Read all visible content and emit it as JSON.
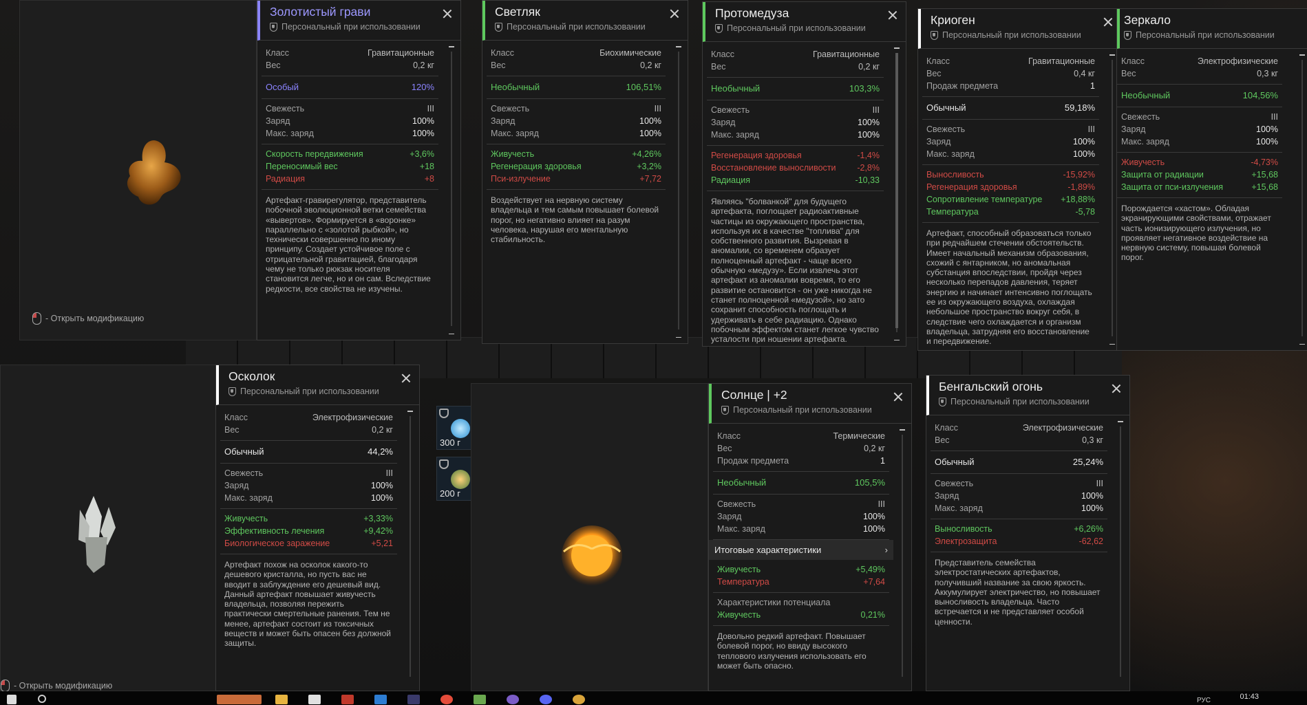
{
  "preview": {
    "open_mod_label": "- Открыть модификацию"
  },
  "slots": [
    {
      "weight": "300 г"
    },
    {
      "weight": "200 г"
    }
  ],
  "taskbar": {
    "time": "01:43",
    "lang": "РУС"
  },
  "cards": {
    "zolotisty": {
      "title": "Золотистый грави",
      "subtitle": "Персональный при использовании",
      "base": [
        {
          "k": "Класс",
          "v": "Гравитационные"
        },
        {
          "k": "Вес",
          "v": "0,2 кг"
        }
      ],
      "rarity": {
        "k": "Особый",
        "v": "120%",
        "color": "#8b84ff"
      },
      "charge": [
        {
          "k": "Свежесть",
          "v": "III"
        },
        {
          "k": "Заряд",
          "v": "100%"
        },
        {
          "k": "Макс. заряд",
          "v": "100%"
        }
      ],
      "effects": [
        {
          "k": "Скорость передвижения",
          "v": "+3,6%",
          "t": "pos"
        },
        {
          "k": "Переносимый вес",
          "v": "+18",
          "t": "pos"
        },
        {
          "k": "Радиация",
          "v": "+8",
          "t": "neg"
        }
      ],
      "desc": "Артефакт-гравирегулятор, представитель побочной эволюционной ветки семейства «вывертов». Формируется в «воронке» параллельно с «золотой рыбкой», но технически совершенно по иному принципу. Создает устойчивое поле с отрицательной гравитацией, благодаря чему не только рюкзак носителя становится легче, но и он сам. Вследствие редкости, все свойства не изучены."
    },
    "svetlyak": {
      "title": "Светляк",
      "subtitle": "Персональный при использовании",
      "base": [
        {
          "k": "Класс",
          "v": "Биохимические"
        },
        {
          "k": "Вес",
          "v": "0,2 кг"
        }
      ],
      "rarity": {
        "k": "Необычный",
        "v": "106,51%",
        "color": "#5fc85f"
      },
      "charge": [
        {
          "k": "Свежесть",
          "v": "III"
        },
        {
          "k": "Заряд",
          "v": "100%"
        },
        {
          "k": "Макс. заряд",
          "v": "100%"
        }
      ],
      "effects": [
        {
          "k": "Живучесть",
          "v": "+4,26%",
          "t": "pos"
        },
        {
          "k": "Регенерация здоровья",
          "v": "+3,2%",
          "t": "pos"
        },
        {
          "k": "Пси-излучение",
          "v": "+7,72",
          "t": "neg"
        }
      ],
      "desc": "Воздействует на нервную систему владельца и тем самым повышает болевой порог, но негативно влияет на разум человека, нарушая его ментальную стабильность."
    },
    "protomeduza": {
      "title": "Протомедуза",
      "subtitle": "Персональный при использовании",
      "base": [
        {
          "k": "Класс",
          "v": "Гравитационные"
        },
        {
          "k": "Вес",
          "v": "0,2 кг"
        }
      ],
      "rarity": {
        "k": "Необычный",
        "v": "103,3%",
        "color": "#5fc85f"
      },
      "charge": [
        {
          "k": "Свежесть",
          "v": "III"
        },
        {
          "k": "Заряд",
          "v": "100%"
        },
        {
          "k": "Макс. заряд",
          "v": "100%"
        }
      ],
      "effects": [
        {
          "k": "Регенерация здоровья",
          "v": "-1,4%",
          "t": "neg"
        },
        {
          "k": "Восстановление выносливости",
          "v": "-2,8%",
          "t": "neg"
        },
        {
          "k": "Радиация",
          "v": "-10,33",
          "t": "pos"
        }
      ],
      "desc": "Являясь \"болванкой\" для будущего артефакта, поглощает радиоактивные частицы из окружающего пространства, используя их в качестве \"топлива\" для собственного развития. Вызревая в аномалии, со временем образует полноценный артефакт - чаще всего обычную «медузу». Если извлечь этот артефакт из аномалии вовремя, то его развитие остановится - он уже никогда не станет полноценной «медузой», но зато сохранит способность поглощать и удерживать в себе радиацию. Однако побочным эффектом станет легкое чувство усталости при ношении артефакта."
    },
    "kriogen": {
      "title": "Криоген",
      "subtitle": "Персональный при использовании",
      "base": [
        {
          "k": "Класс",
          "v": "Гравитационные"
        },
        {
          "k": "Вес",
          "v": "0,4 кг"
        },
        {
          "k": "Продаж предмета",
          "v": "1"
        }
      ],
      "rarity": {
        "k": "Обычный",
        "v": "59,18%",
        "color": "#e8e8e8"
      },
      "charge": [
        {
          "k": "Свежесть",
          "v": "III"
        },
        {
          "k": "Заряд",
          "v": "100%"
        },
        {
          "k": "Макс. заряд",
          "v": "100%"
        }
      ],
      "effects": [
        {
          "k": "Выносливость",
          "v": "-15,92%",
          "t": "neg"
        },
        {
          "k": "Регенерация здоровья",
          "v": "-1,89%",
          "t": "neg"
        },
        {
          "k": "Сопротивление температуре",
          "v": "+18,88%",
          "t": "pos"
        },
        {
          "k": "Температура",
          "v": "-5,78",
          "t": "pos"
        }
      ],
      "desc": "Артефакт, способный образоваться только при редчайшем стечении обстоятельств. Имеет начальный механизм образования, схожий с янтарником, но аномальная субстанция впоследствии, пройдя через несколько перепадов давления, теряет энергию и начинает интенсивно поглощать ее из окружающего воздуха, охлаждая небольшое пространство вокруг себя, в следствие чего охлаждается и организм владельца, затрудняя его восстановление и передвижение."
    },
    "zerkalo": {
      "title": "Зеркало",
      "subtitle": "Персональный при использовании",
      "base": [
        {
          "k": "Класс",
          "v": "Электрофизические"
        },
        {
          "k": "Вес",
          "v": "0,3 кг"
        }
      ],
      "rarity": {
        "k": "Необычный",
        "v": "104,56%",
        "color": "#5fc85f"
      },
      "charge": [
        {
          "k": "Свежесть",
          "v": "III"
        },
        {
          "k": "Заряд",
          "v": "100%"
        },
        {
          "k": "Макс. заряд",
          "v": "100%"
        }
      ],
      "effects": [
        {
          "k": "Живучесть",
          "v": "-4,73%",
          "t": "neg"
        },
        {
          "k": "Защита от радиации",
          "v": "+15,68",
          "t": "pos"
        },
        {
          "k": "Защита от пси-излучения",
          "v": "+15,68",
          "t": "pos"
        }
      ],
      "desc": "Порождается «хастом». Обладая экранирующими свойствами, отражает часть ионизирующего излучения, но проявляет негативное воздействие на нервную систему, повышая болевой порог."
    },
    "oskolok": {
      "title": "Осколок",
      "subtitle": "Персональный при использовании",
      "base": [
        {
          "k": "Класс",
          "v": "Электрофизические"
        },
        {
          "k": "Вес",
          "v": "0,2 кг"
        }
      ],
      "rarity": {
        "k": "Обычный",
        "v": "44,2%",
        "color": "#e8e8e8"
      },
      "charge": [
        {
          "k": "Свежесть",
          "v": "III"
        },
        {
          "k": "Заряд",
          "v": "100%"
        },
        {
          "k": "Макс. заряд",
          "v": "100%"
        }
      ],
      "effects": [
        {
          "k": "Живучесть",
          "v": "+3,33%",
          "t": "pos"
        },
        {
          "k": "Эффективность лечения",
          "v": "+9,42%",
          "t": "pos"
        },
        {
          "k": "Биологическое заражение",
          "v": "+5,21",
          "t": "neg"
        }
      ],
      "desc": "Артефакт похож на осколок какого-то дешевого кристалла, но пусть вас не вводит в заблуждение его дешевый вид. Данный артефакт повышает живучесть владельца, позволяя пережить практически смертельные ранения. Тем не менее, артефакт состоит из токсичных веществ и может быть опасен без должной защиты."
    },
    "solnce": {
      "title": "Солнце | +2",
      "subtitle": "Персональный при использовании",
      "base": [
        {
          "k": "Класс",
          "v": "Термические"
        },
        {
          "k": "Вес",
          "v": "0,2 кг"
        },
        {
          "k": "Продаж предмета",
          "v": "1"
        }
      ],
      "rarity": {
        "k": "Необычный",
        "v": "105,5%",
        "color": "#5fc85f"
      },
      "charge": [
        {
          "k": "Свежесть",
          "v": "III"
        },
        {
          "k": "Заряд",
          "v": "100%"
        },
        {
          "k": "Макс. заряд",
          "v": "100%"
        }
      ],
      "total_label": "Итоговые характеристики",
      "effects": [
        {
          "k": "Живучесть",
          "v": "+5,49%",
          "t": "pos"
        },
        {
          "k": "Температура",
          "v": "+7,64",
          "t": "neg"
        }
      ],
      "potential_label": "Характеристики потенциала",
      "potential": {
        "k": "Живучесть",
        "v": "0,21%"
      },
      "desc": "Довольно редкий артефакт. Повышает болевой порог, но ввиду высокого теплового излучения использовать его может быть опасно."
    },
    "bengalsky": {
      "title": "Бенгальский огонь",
      "subtitle": "Персональный при использовании",
      "base": [
        {
          "k": "Класс",
          "v": "Электрофизические"
        },
        {
          "k": "Вес",
          "v": "0,3 кг"
        }
      ],
      "rarity": {
        "k": "Обычный",
        "v": "25,24%",
        "color": "#e8e8e8"
      },
      "charge": [
        {
          "k": "Свежесть",
          "v": "III"
        },
        {
          "k": "Заряд",
          "v": "100%"
        },
        {
          "k": "Макс. заряд",
          "v": "100%"
        }
      ],
      "effects": [
        {
          "k": "Выносливость",
          "v": "+6,26%",
          "t": "pos"
        },
        {
          "k": "Электрозащита",
          "v": "-62,62",
          "t": "neg"
        }
      ],
      "desc": "Представитель семейства электростатических артефактов, получивший название за свою яркость. Аккумулирует электричество, но повышает выносливость владельца. Часто встречается и не представляет особой ценности."
    }
  }
}
